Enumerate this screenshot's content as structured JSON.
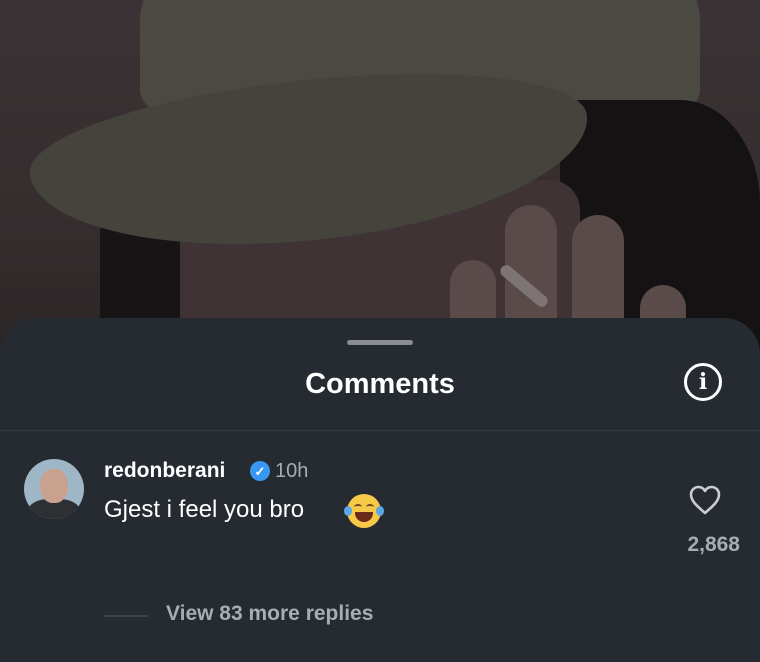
{
  "sheet": {
    "title": "Comments"
  },
  "comment": {
    "username": "redonberani",
    "verified": true,
    "time": "10h",
    "text": "Gjest i feel you bro",
    "emoji": "face-with-tears-of-joy",
    "like_count": "2,868"
  },
  "replies": {
    "label": "View 83 more replies"
  },
  "colors": {
    "sheet_bg": "#262a31",
    "verified_blue": "#3897f0",
    "secondary_text": "#a8acb3"
  }
}
